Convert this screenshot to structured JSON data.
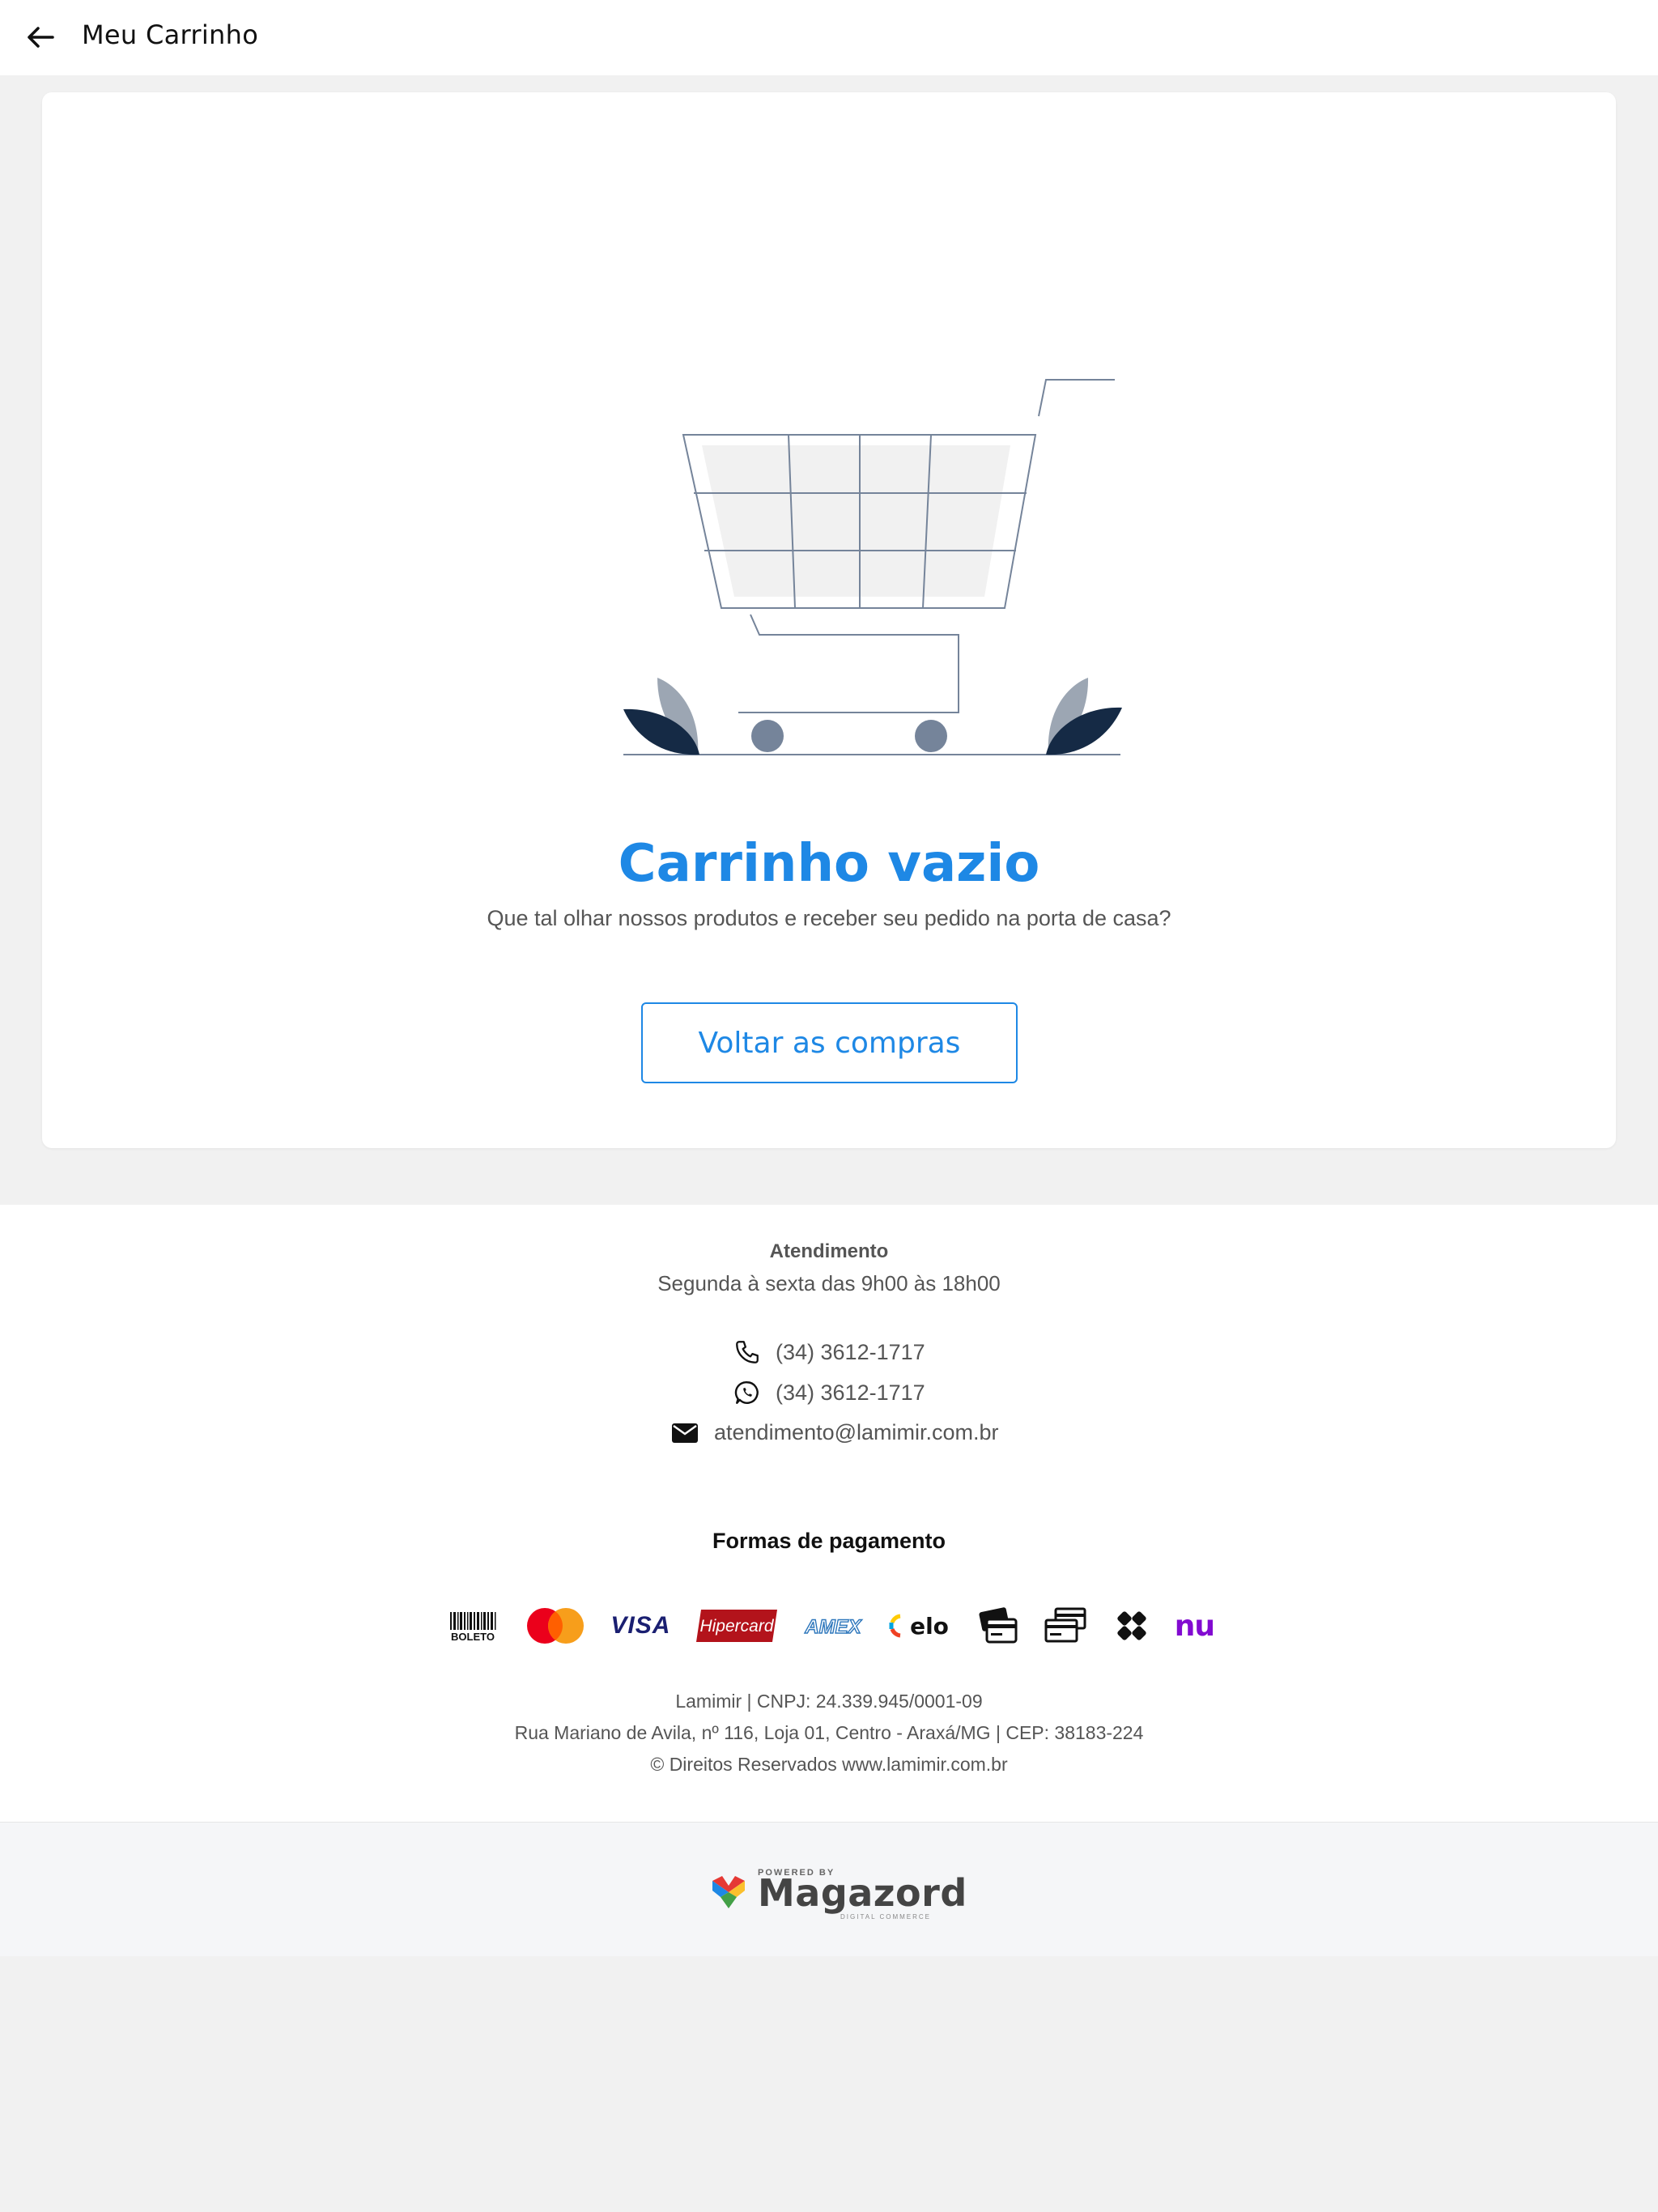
{
  "header": {
    "title": "Meu Carrinho",
    "back_icon": "arrow-left-icon"
  },
  "empty_cart": {
    "illustration": "empty-shopping-cart",
    "title": "Carrinho vazio",
    "subtitle": "Que tal olhar nossos produtos e receber seu pedido na porta de casa?",
    "button_label": "Voltar as compras"
  },
  "footer": {
    "atendimento_title": "Atendimento",
    "atendimento_hours": "Segunda à sexta das 9h00 às 18h00",
    "phone": "(34) 3612-1717",
    "whatsapp": "(34) 3612-1717",
    "email": "atendimento@lamimir.com.br",
    "payment_title": "Formas de pagamento",
    "payment_methods": [
      {
        "name": "boleto",
        "label": "BOLETO"
      },
      {
        "name": "mastercard",
        "label": ""
      },
      {
        "name": "visa",
        "label": "VISA"
      },
      {
        "name": "hipercard",
        "label": "Hipercard"
      },
      {
        "name": "amex",
        "label": "AMEX"
      },
      {
        "name": "elo",
        "label": "elo"
      },
      {
        "name": "credit-card",
        "label": ""
      },
      {
        "name": "debit-card",
        "label": ""
      },
      {
        "name": "pix",
        "label": ""
      },
      {
        "name": "nubank",
        "label": "nu"
      }
    ],
    "legal_line1": "Lamimir | CNPJ: 24.339.945/0001-09",
    "legal_line2": "Rua Mariano de Avila, nº 116, Loja 01, Centro - Araxá/MG | CEP: 38183-224",
    "legal_line3": "© Direitos Reservados www.lamimir.com.br"
  },
  "powered_by": {
    "small": "POWERED BY",
    "brand": "Magazord",
    "tag": "DIGITAL COMMERCE"
  },
  "colors": {
    "accent": "#1e88e5",
    "navy": "#152a45",
    "slate": "#75849a",
    "leaf_light": "#9ca6b3"
  }
}
